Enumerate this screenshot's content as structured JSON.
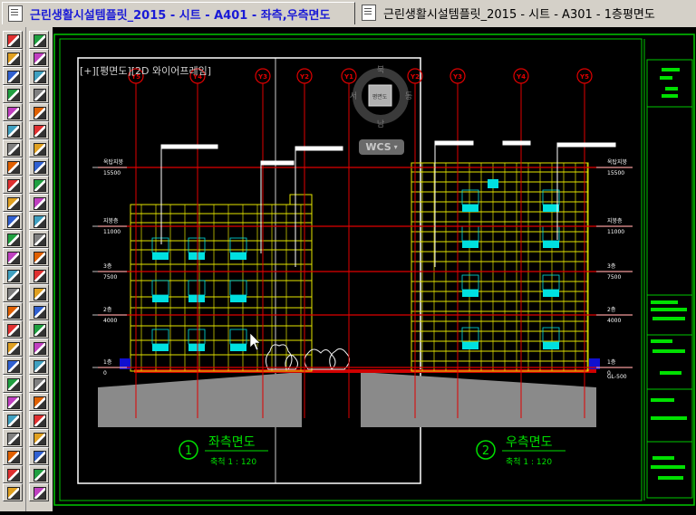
{
  "tabs": [
    {
      "label": "근린생활시설템플릿_2015 - 시트 - A401 - 좌측,우측면도",
      "active": true
    },
    {
      "label": "근린생활시설템플릿_2015 - 시트 - A301 - 1층평면도",
      "active": false
    }
  ],
  "viewport": {
    "label": "[+][평면도][2D 와이어프레임]"
  },
  "viewcube": {
    "north": "북",
    "south": "남",
    "east": "동",
    "west": "서",
    "top": "평면도"
  },
  "wcs": {
    "label": "WCS"
  },
  "grid_markers": {
    "left": [
      "Y5",
      "Y4",
      "Y3",
      "Y2",
      "Y1"
    ],
    "right": [
      "Y2",
      "Y3",
      "Y4",
      "Y5"
    ]
  },
  "levels_left": [
    {
      "name": "옥탑지붕",
      "value": "15500"
    },
    {
      "name": "지붕층",
      "value": "11000"
    },
    {
      "name": "3층",
      "value": "7500"
    },
    {
      "name": "2층",
      "value": "4000"
    },
    {
      "name": "1층",
      "value": "0"
    }
  ],
  "levels_right": [
    {
      "name": "옥탑지붕",
      "value": "15500"
    },
    {
      "name": "지붕층",
      "value": "11000"
    },
    {
      "name": "3층",
      "value": "7500"
    },
    {
      "name": "2층",
      "value": "4000"
    },
    {
      "name": "1층",
      "value": "0"
    },
    {
      "name": "GL",
      "value": "-500"
    }
  ],
  "drawings": [
    {
      "number": "1",
      "title": "좌측면도",
      "scale": "축척 1 : 120"
    },
    {
      "number": "2",
      "title": "우측면도",
      "scale": "축척 1 : 120"
    }
  ],
  "colors": {
    "background": "#000000",
    "border_green": "#00c800",
    "grid_red": "#e00000",
    "building_yellow": "#e6e600",
    "window_cyan": "#00e0e0",
    "ground_gray": "#8a8a8a",
    "tree_white": "#f0f0f0",
    "tab_active_text": "#1a1ad6"
  }
}
